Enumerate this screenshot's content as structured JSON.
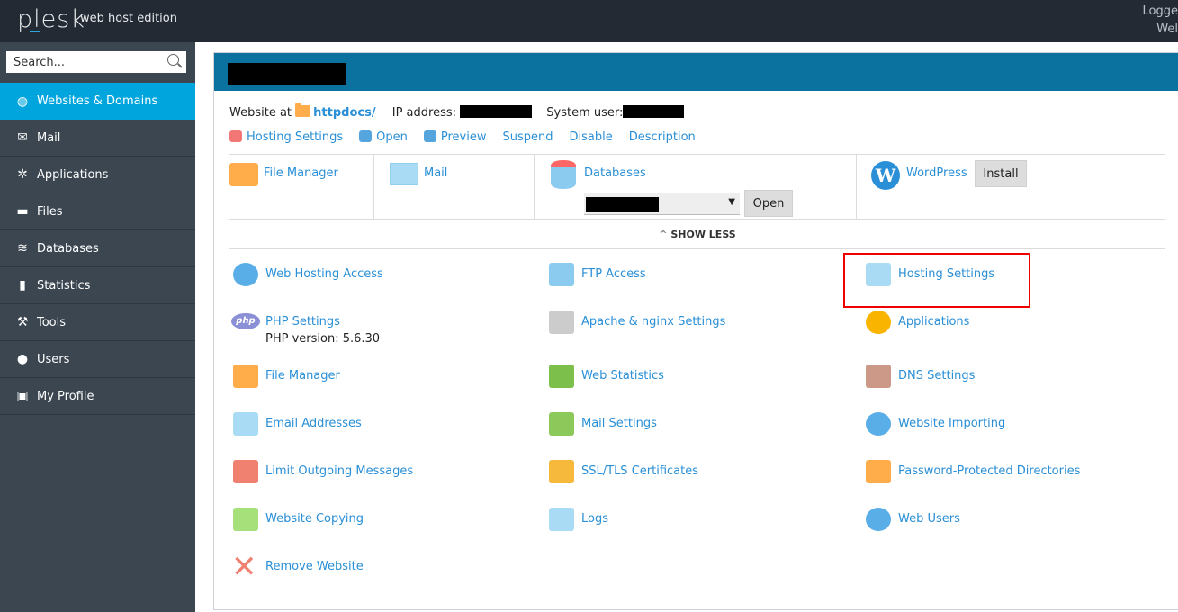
{
  "header": {
    "logo": "plesk",
    "edition": "web host edition",
    "user_line1": "Logge",
    "user_line2": "Wel"
  },
  "sidebar": {
    "search_placeholder": "Search...",
    "items": [
      {
        "label": "Websites & Domains",
        "icon": "globe-icon",
        "active": true
      },
      {
        "label": "Mail",
        "icon": "envelope-icon"
      },
      {
        "label": "Applications",
        "icon": "gear-icon"
      },
      {
        "label": "Files",
        "icon": "folder-icon"
      },
      {
        "label": "Databases",
        "icon": "database-icon"
      },
      {
        "label": "Statistics",
        "icon": "bar-chart-icon"
      },
      {
        "label": "Tools",
        "icon": "tools-icon"
      },
      {
        "label": "Users",
        "icon": "user-icon"
      },
      {
        "label": "My Profile",
        "icon": "profile-icon"
      }
    ]
  },
  "site": {
    "website_at": "Website at",
    "docroot": "httpdocs/",
    "ip_label": "IP address:",
    "sysuser_label": "System user:",
    "actions": [
      "Hosting Settings",
      "Open",
      "Preview",
      "Suspend",
      "Disable",
      "Description"
    ]
  },
  "quick": {
    "file_manager": "File Manager",
    "mail": "Mail",
    "databases": "Databases",
    "open": "Open",
    "wordpress": "WordPress",
    "install": "Install",
    "show_less": "SHOW LESS"
  },
  "tools": [
    {
      "label": "Web Hosting Access",
      "icon": "globe-flag-icon"
    },
    {
      "label": "FTP Access",
      "icon": "ftp-folder-icon"
    },
    {
      "label": "Hosting Settings",
      "icon": "hosting-settings-icon",
      "highlighted": true
    },
    {
      "label": "PHP Settings",
      "sub": "PHP version: 5.6.30",
      "icon": "php-icon"
    },
    {
      "label": "Apache & nginx Settings",
      "icon": "server-icon"
    },
    {
      "label": "Applications",
      "icon": "gear-icon"
    },
    {
      "label": "File Manager",
      "icon": "folder-icon"
    },
    {
      "label": "Web Statistics",
      "icon": "bar-chart-icon"
    },
    {
      "label": "DNS Settings",
      "icon": "dns-flags-icon"
    },
    {
      "label": "Email Addresses",
      "icon": "envelope-icon"
    },
    {
      "label": "Mail Settings",
      "icon": "mail-settings-icon"
    },
    {
      "label": "Website Importing",
      "icon": "globe-import-icon"
    },
    {
      "label": "Limit Outgoing Messages",
      "icon": "envelope-red-icon"
    },
    {
      "label": "SSL/TLS Certificates",
      "icon": "certificate-icon"
    },
    {
      "label": "Password-Protected Directories",
      "icon": "locked-folder-icon"
    },
    {
      "label": "Website Copying",
      "icon": "copy-icon"
    },
    {
      "label": "Logs",
      "icon": "log-file-icon"
    },
    {
      "label": "Web Users",
      "icon": "globe-user-icon"
    },
    {
      "label": "Remove Website",
      "icon": "remove-x-icon"
    }
  ],
  "colors": {
    "topbar": "#232a33",
    "sidebar": "#3b4651",
    "active": "#00a5dd",
    "panel_header": "#0b72a0",
    "link": "#2a8fd6",
    "highlight": "#e00000"
  }
}
